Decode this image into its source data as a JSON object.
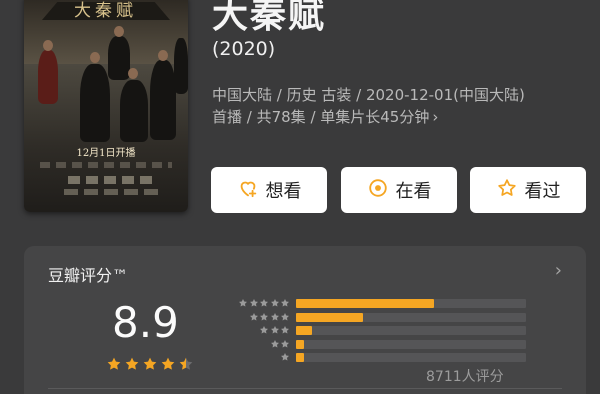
{
  "movie": {
    "poster_title": "大秦赋",
    "poster_date": "12月1日开播",
    "title": "大秦赋",
    "year": "(2020)",
    "meta_line1": "中国大陆 / 历史 古装 / 2020-12-01(中国大陆)",
    "meta_line2": "首播 / 共78集 / 单集片长45分钟",
    "meta_chevron": "›"
  },
  "actions": [
    {
      "label": "想看",
      "icon": "heart-add-icon"
    },
    {
      "label": "在看",
      "icon": "circle-dot-icon"
    },
    {
      "label": "看过",
      "icon": "star-outline-icon"
    }
  ],
  "rating": {
    "brand": "豆瓣评分™",
    "chevron": "›",
    "score": "8.9",
    "stars_value": 4.5,
    "distribution": [
      {
        "stars": 5,
        "fraction": 0.6
      },
      {
        "stars": 4,
        "fraction": 0.29
      },
      {
        "stars": 3,
        "fraction": 0.07
      },
      {
        "stars": 2,
        "fraction": 0.02
      },
      {
        "stars": 1,
        "fraction": 0.02
      }
    ],
    "count_text": "8711人评分"
  },
  "colors": {
    "accent": "#f5a623",
    "background": "#3a3a3b",
    "card": "#454546",
    "button": "#ffffff"
  }
}
